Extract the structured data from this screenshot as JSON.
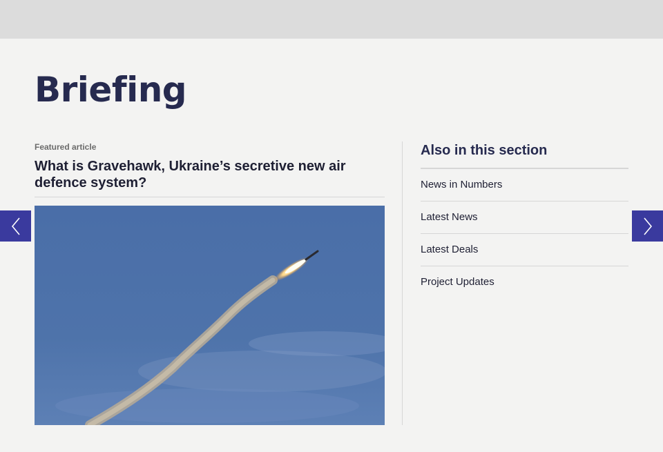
{
  "page": {
    "title": "Briefing"
  },
  "featured": {
    "kicker": "Featured article",
    "headline": "What is Gravehawk, Ukraine’s secretive new air defence system?"
  },
  "also_in_section": {
    "heading": "Also in this section",
    "items": [
      {
        "label": "News in Numbers"
      },
      {
        "label": "Latest News"
      },
      {
        "label": "Latest Deals"
      },
      {
        "label": "Project Updates"
      }
    ]
  },
  "carousel": {
    "prev_icon": "chevron-left-icon",
    "next_icon": "chevron-right-icon"
  },
  "colors": {
    "accent": "#3a3a9e",
    "title": "#262a4f",
    "background": "#f3f3f2",
    "topbar": "#dcdcdc"
  }
}
